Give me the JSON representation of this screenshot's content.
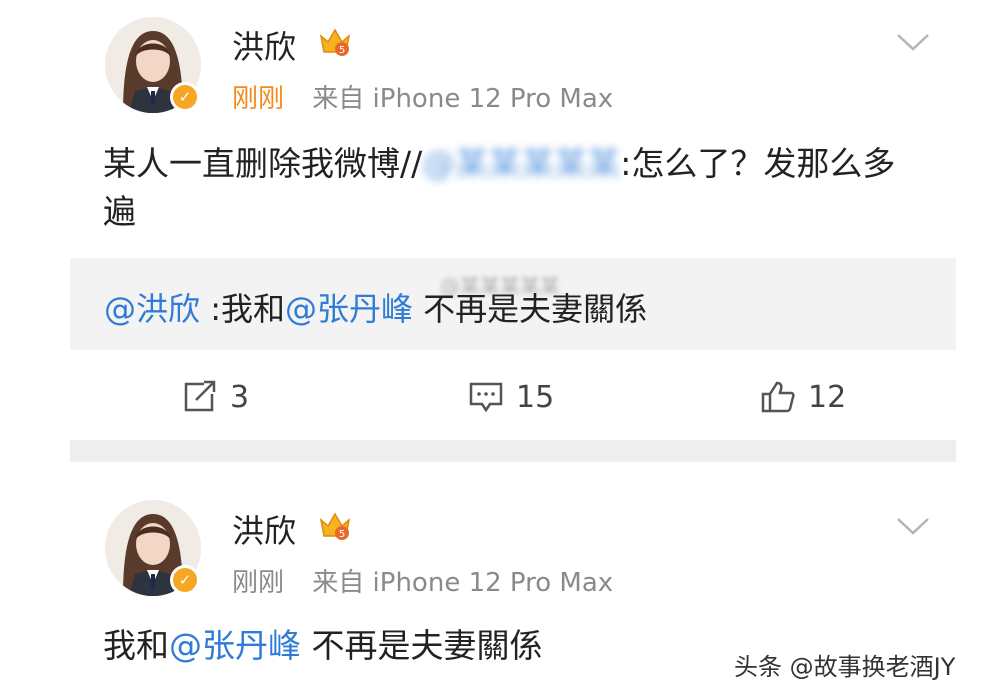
{
  "post1": {
    "username": "洪欣",
    "time": "刚刚",
    "source": "来自 iPhone 12 Pro Max",
    "body_before": "某人一直删除我微博//",
    "body_blurred": "@某某某某某",
    "body_after": ":怎么了？发那么多遍",
    "quote": {
      "mention_user": "@洪欣",
      "text_before": " :我和",
      "mention_partner": "@张丹峰",
      "text_after": " 不再是夫妻關係",
      "blurred_overlay": "@某某某某某"
    },
    "actions": {
      "repost_count": "3",
      "comment_count": "15",
      "like_count": "12"
    }
  },
  "post2": {
    "username": "洪欣",
    "time": "刚刚",
    "source": "来自 iPhone 12 Pro Max",
    "body_before": "我和",
    "mention_partner": "@张丹峰",
    "body_after": " 不再是夫妻關係"
  },
  "watermark": "头条 @故事换老酒JY",
  "colors": {
    "accent_blue": "#2f7bd6",
    "time_orange": "#f28b1c",
    "badge_gold": "#f5a623",
    "quote_bg": "#f3f3f3"
  }
}
